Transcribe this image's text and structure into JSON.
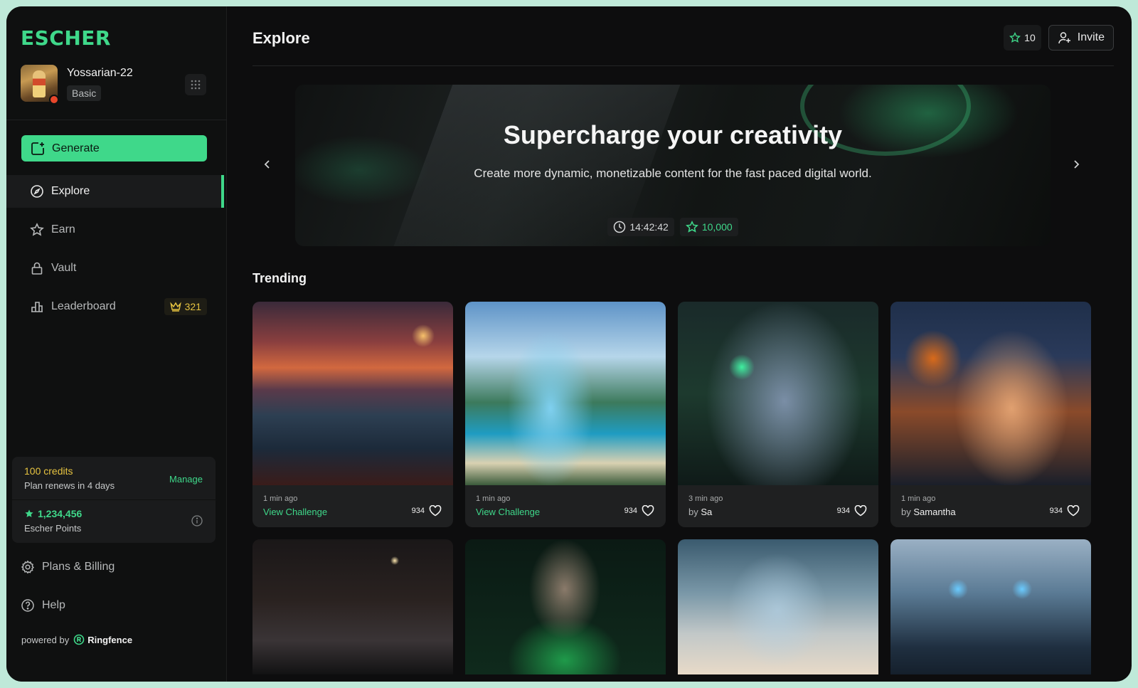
{
  "brand": {
    "logo": "ESCHER",
    "accent": "#3fd88a"
  },
  "user": {
    "name": "Yossarian-22",
    "plan": "Basic"
  },
  "sidebar": {
    "generate_label": "Generate",
    "items": [
      {
        "label": "Explore",
        "icon": "compass-icon",
        "active": true
      },
      {
        "label": "Earn",
        "icon": "star-icon"
      },
      {
        "label": "Vault",
        "icon": "lock-icon"
      },
      {
        "label": "Leaderboard",
        "icon": "podium-icon",
        "badge": "321"
      }
    ],
    "credits": {
      "title": "100 credits",
      "renew": "Plan renews in 4 days",
      "manage": "Manage",
      "points": "1,234,456",
      "points_label": "Escher Points"
    },
    "footer": [
      {
        "label": "Plans & Billing",
        "icon": "gear-icon"
      },
      {
        "label": "Help",
        "icon": "help-icon"
      }
    ],
    "powered_by": "powered by",
    "powered_brand": "Ringfence"
  },
  "header": {
    "title": "Explore",
    "stars": "10",
    "invite": "Invite"
  },
  "hero": {
    "title": "Supercharge your creativity",
    "subtitle": "Create more dynamic, monetizable content for the fast paced digital world.",
    "timer": "14:42:42",
    "reward": "10,000"
  },
  "trending": {
    "title": "Trending",
    "cards": [
      {
        "time": "1 min ago",
        "link": "View Challenge",
        "likes": "934"
      },
      {
        "time": "1 min ago",
        "link": "View Challenge",
        "likes": "934"
      },
      {
        "time": "3 min ago",
        "by_prefix": "by",
        "author": "Sa",
        "likes": "934"
      },
      {
        "time": "1 min ago",
        "by_prefix": "by",
        "author": "Samantha",
        "likes": "934"
      }
    ]
  }
}
